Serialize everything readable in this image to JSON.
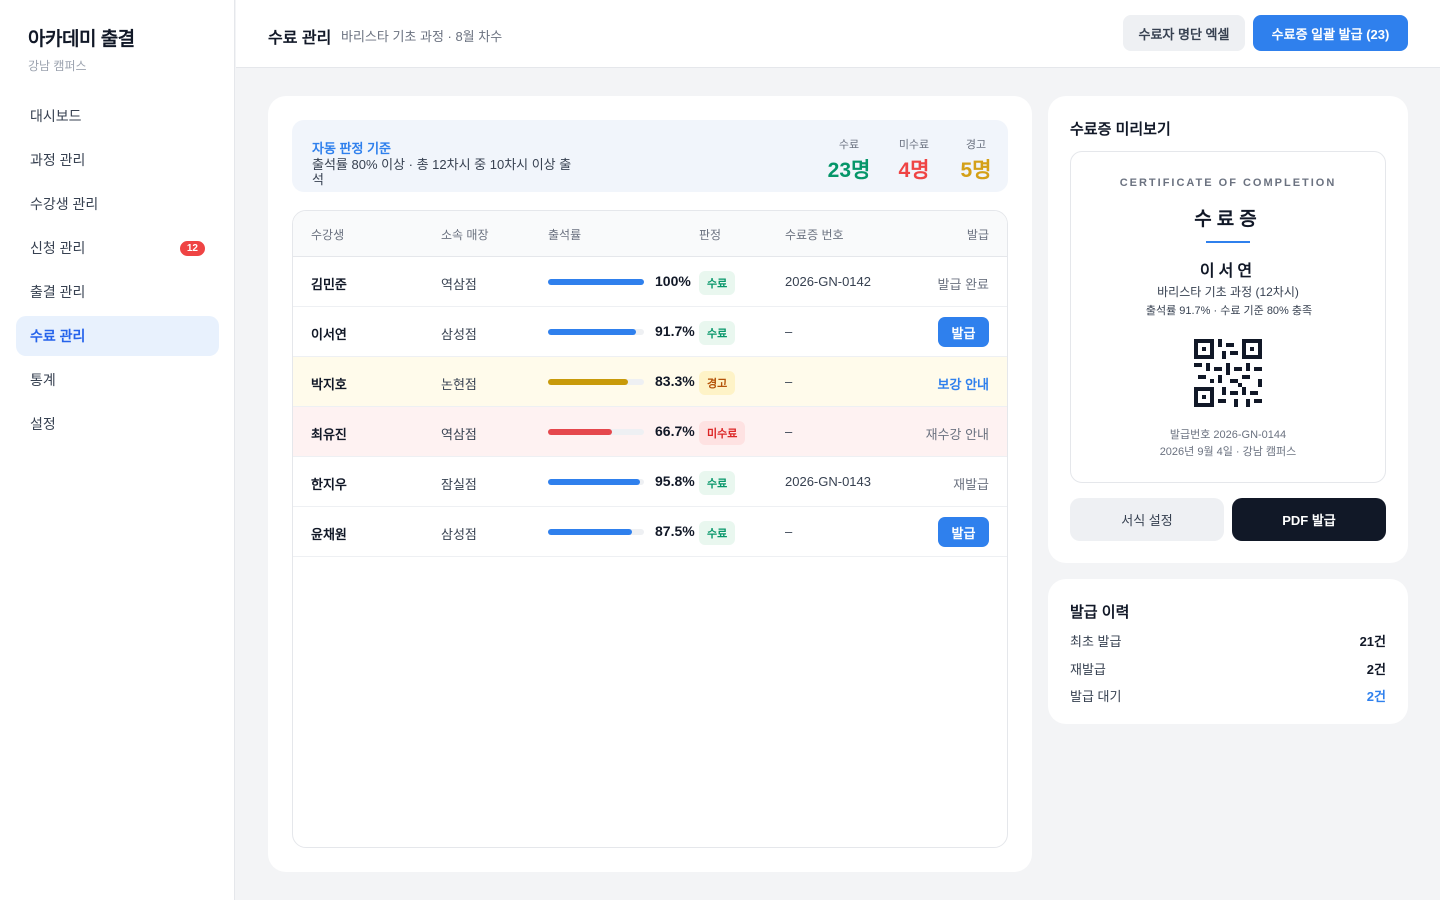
{
  "app": {
    "title": "아카데미 출결",
    "campus": "강남 캠퍼스"
  },
  "sidebar": {
    "items": [
      {
        "label": "대시보드"
      },
      {
        "label": "과정 관리"
      },
      {
        "label": "수강생 관리"
      },
      {
        "label": "신청 관리",
        "badge": "12"
      },
      {
        "label": "출결 관리"
      },
      {
        "label": "수료 관리",
        "active": true
      },
      {
        "label": "통계"
      },
      {
        "label": "설정"
      }
    ]
  },
  "header": {
    "title": "수료 관리",
    "subtitle": "바리스타 기초 과정 · 8월 차수",
    "excel_label": "수료자 명단 엑셀",
    "bulk_label": "수료증 일괄 발급 (23)"
  },
  "criteria": {
    "title": "자동 판정 기준",
    "desc": "출석률 80% 이상 · 총 12차시 중 10차시 이상 출석",
    "stats": [
      {
        "label": "수료",
        "value": "23명",
        "color": "#059669"
      },
      {
        "label": "미수료",
        "value": "4명",
        "color": "#ef4444"
      },
      {
        "label": "경고",
        "value": "5명",
        "color": "#d4a017"
      }
    ]
  },
  "table": {
    "headers": [
      "수강생",
      "소속 매장",
      "출석률",
      "판정",
      "수료증 번호",
      "발급"
    ],
    "rows": [
      {
        "name": "김민준",
        "branch": "역삼점",
        "rate": 1.0,
        "rate_text": "100%",
        "status": "수료",
        "type": "pass",
        "cert": "2026-GN-0142",
        "action": "발급 완료",
        "action_type": "text"
      },
      {
        "name": "이서연",
        "branch": "삼성점",
        "rate": 0.917,
        "rate_text": "91.7%",
        "status": "수료",
        "type": "pass",
        "cert": "–",
        "action": "발급",
        "action_type": "button"
      },
      {
        "name": "박지호",
        "branch": "논현점",
        "rate": 0.833,
        "rate_text": "83.3%",
        "status": "경고",
        "type": "warn",
        "cert": "–",
        "action": "보강 안내",
        "action_type": "link"
      },
      {
        "name": "최유진",
        "branch": "역삼점",
        "rate": 0.667,
        "rate_text": "66.7%",
        "status": "미수료",
        "type": "fail",
        "cert": "–",
        "action": "재수강 안내",
        "action_type": "text"
      },
      {
        "name": "한지우",
        "branch": "잠실점",
        "rate": 0.958,
        "rate_text": "95.8%",
        "status": "수료",
        "type": "pass",
        "cert": "2026-GN-0143",
        "action": "재발급",
        "action_type": "text"
      },
      {
        "name": "윤채원",
        "branch": "삼성점",
        "rate": 0.875,
        "rate_text": "87.5%",
        "status": "수료",
        "type": "pass",
        "cert": "–",
        "action": "발급",
        "action_type": "button"
      }
    ]
  },
  "preview": {
    "title": "수료증 미리보기",
    "cert_en": "CERTIFICATE OF COMPLETION",
    "cert_ko": "수료증",
    "name": "이서연",
    "course": "바리스타 기초 과정 (12차시)",
    "rate_line": "출석률 91.7% · 수료 기준 80% 충족",
    "cert_no": "발급번호 2026-GN-0144",
    "date": "2026년 9월 4일 · 강남 캠퍼스",
    "format_label": "서식 설정",
    "pdf_label": "PDF 발급"
  },
  "history": {
    "title": "발급 이력",
    "items": [
      {
        "label": "최초 발급",
        "value": "21건"
      },
      {
        "label": "재발급",
        "value": "2건"
      },
      {
        "label": "발급 대기",
        "value": "2건",
        "highlight": true
      }
    ]
  },
  "colors": {
    "accent": "#2f80ed",
    "pass": "#2f80ed",
    "warn": "#c89a0a",
    "fail": "#e5484d"
  }
}
